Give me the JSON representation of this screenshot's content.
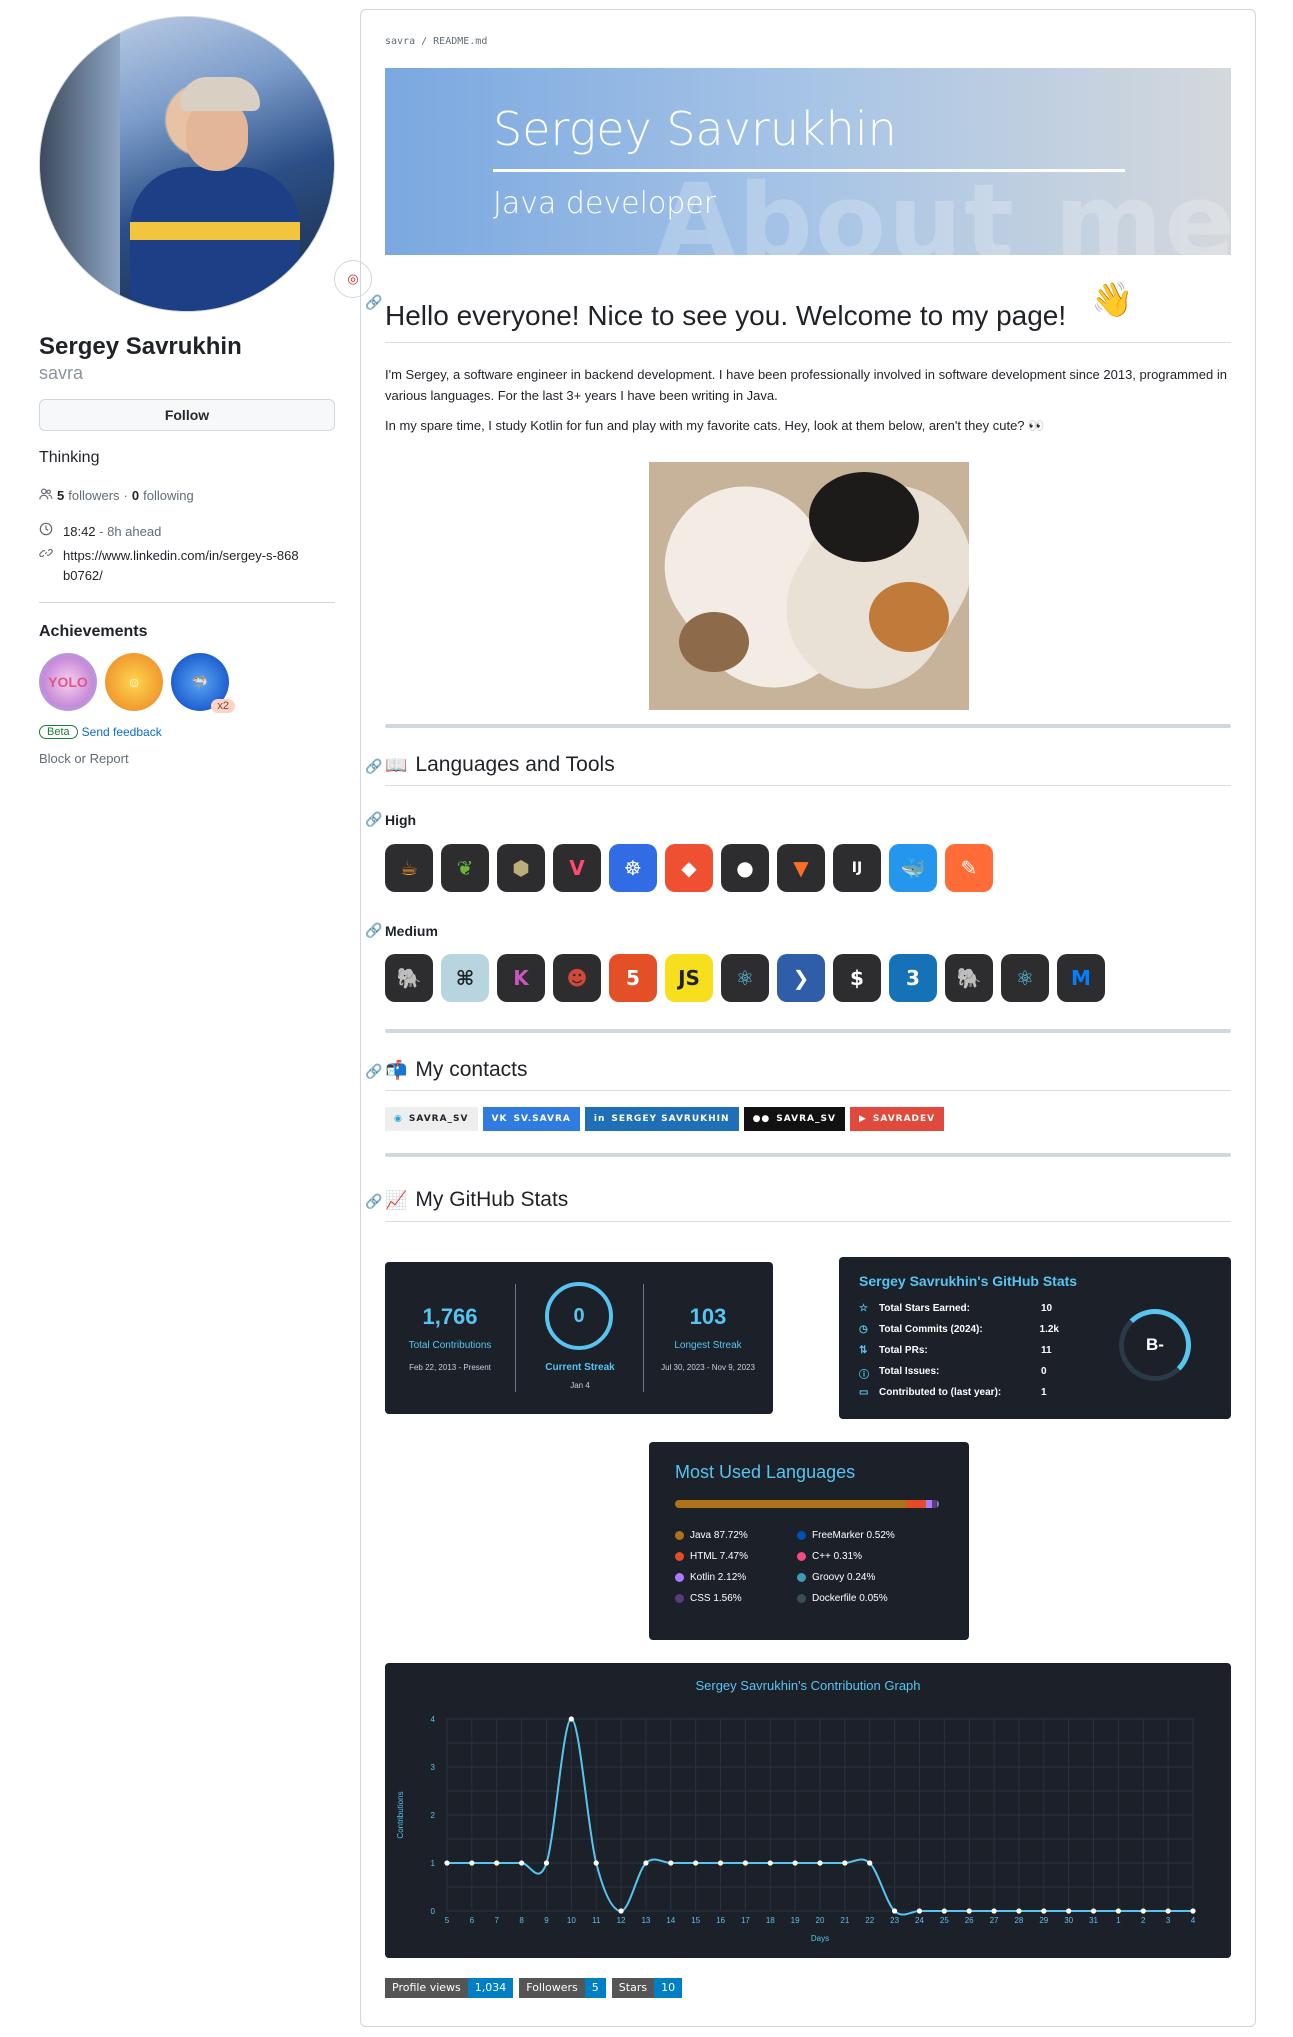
{
  "profile": {
    "name": "Sergey Savrukhin",
    "login": "savra",
    "follow_label": "Follow",
    "bio": "Thinking",
    "followers_count": "5",
    "followers_label": "followers",
    "following_count": "0",
    "following_label": "following",
    "separator": "·",
    "time": "18:42",
    "time_offset": "- 8h ahead",
    "link": "https://www.linkedin.com/in/sergey-s-868b0762/",
    "achievements_title": "Achievements",
    "achievement_count": "x2",
    "beta_label": "Beta",
    "feedback_label": "Send feedback",
    "block_label": "Block or Report"
  },
  "readme": {
    "path": "savra / README.md",
    "banner_name": "Sergey Savrukhin",
    "banner_role": "Java developer",
    "banner_bg": "About me",
    "greeting": "Hello everyone! Nice to see you. Welcome to my page!",
    "wave": "👋",
    "intro": "I'm Sergey, a software engineer in backend development. I have been professionally involved in software development since 2013, programmed in various languages. For the last 3+ years I have been writing in Java.",
    "spare": "In my spare time, I study Kotlin for fun and play with my favorite cats. Hey, look at them below, aren't they cute? 👀",
    "languages_title": "Languages and Tools",
    "languages_emoji": "📖",
    "high_label": "High",
    "medium_label": "Medium",
    "high_icons": [
      "java-icon",
      "spring-icon",
      "hibernate-icon",
      "vaadin-icon",
      "kubernetes-icon",
      "git-icon",
      "github-icon",
      "gitlab-icon",
      "intellij-icon",
      "docker-icon",
      "postman-icon"
    ],
    "medium_icons": [
      "postgresql-icon",
      "kafka-icon",
      "kotlin-icon",
      "jenkins-icon",
      "html5-icon",
      "javascript-icon",
      "react-icon",
      "powershell-icon",
      "bash-icon",
      "css3-icon",
      "gradle-icon",
      "react-native-icon",
      "material-ui-icon"
    ],
    "contacts_title": "My contacts",
    "contacts_emoji": "📬",
    "contacts": [
      "SAVRA_SV",
      "SV.SAVRA",
      "SERGEY SAVRUKHIN",
      "SAVRA_SV",
      "SAVRADEV"
    ],
    "stats_title": "My GitHub Stats",
    "stats_emoji": "📈"
  },
  "streak": {
    "total": "1,766",
    "total_label": "Total Contributions",
    "total_range": "Feb 22, 2013 - Present",
    "current": "0",
    "current_label": "Current Streak",
    "current_date": "Jan 4",
    "longest": "103",
    "longest_label": "Longest Streak",
    "longest_range": "Jul 30, 2023 - Nov 9, 2023"
  },
  "stats": {
    "title": "Sergey Savrukhin's GitHub Stats",
    "rows": [
      {
        "label": "Total Stars Earned:",
        "value": "10"
      },
      {
        "label": "Total Commits (2024):",
        "value": "1.2k"
      },
      {
        "label": "Total PRs:",
        "value": "11"
      },
      {
        "label": "Total Issues:",
        "value": "0"
      },
      {
        "label": "Contributed to (last year):",
        "value": "1"
      }
    ],
    "grade": "B-"
  },
  "languages": {
    "title": "Most Used Languages",
    "items": [
      {
        "label": "Java 87.72%",
        "color": "#b07219",
        "pct": 87.72
      },
      {
        "label": "HTML 7.47%",
        "color": "#e34c26",
        "pct": 7.47
      },
      {
        "label": "Kotlin 2.12%",
        "color": "#a97bff",
        "pct": 2.12
      },
      {
        "label": "CSS 1.56%",
        "color": "#563d7c",
        "pct": 1.56
      },
      {
        "label": "FreeMarker 0.52%",
        "color": "#0050b2",
        "pct": 0.52
      },
      {
        "label": "C++ 0.31%",
        "color": "#f34b7d",
        "pct": 0.31
      },
      {
        "label": "Groovy 0.24%",
        "color": "#4298b8",
        "pct": 0.24
      },
      {
        "label": "Dockerfile 0.05%",
        "color": "#384d54",
        "pct": 0.05
      }
    ]
  },
  "chart_data": {
    "type": "line",
    "title": "Sergey Savrukhin's Contribution Graph",
    "xlabel": "Days",
    "ylabel": "Contributions",
    "x": [
      "5",
      "6",
      "7",
      "8",
      "9",
      "10",
      "11",
      "12",
      "13",
      "14",
      "15",
      "16",
      "17",
      "18",
      "19",
      "20",
      "21",
      "22",
      "23",
      "24",
      "25",
      "26",
      "27",
      "28",
      "29",
      "30",
      "31",
      "1",
      "2",
      "3",
      "4"
    ],
    "values": [
      1,
      1,
      1,
      1,
      1,
      4,
      1,
      0,
      1,
      1,
      1,
      1,
      1,
      1,
      1,
      1,
      1,
      1,
      0,
      0,
      0,
      0,
      0,
      0,
      0,
      0,
      0,
      0,
      0,
      0,
      0
    ],
    "ylim": [
      0,
      4
    ],
    "yticks": [
      "0",
      "1",
      "2",
      "3",
      "4"
    ],
    "grid": true,
    "color": "#58c4f0"
  },
  "footer": {
    "views_label": "Profile views",
    "views_value": "1,034",
    "followers_label": "Followers",
    "followers_value": "5",
    "stars_label": "Stars",
    "stars_value": "10"
  }
}
